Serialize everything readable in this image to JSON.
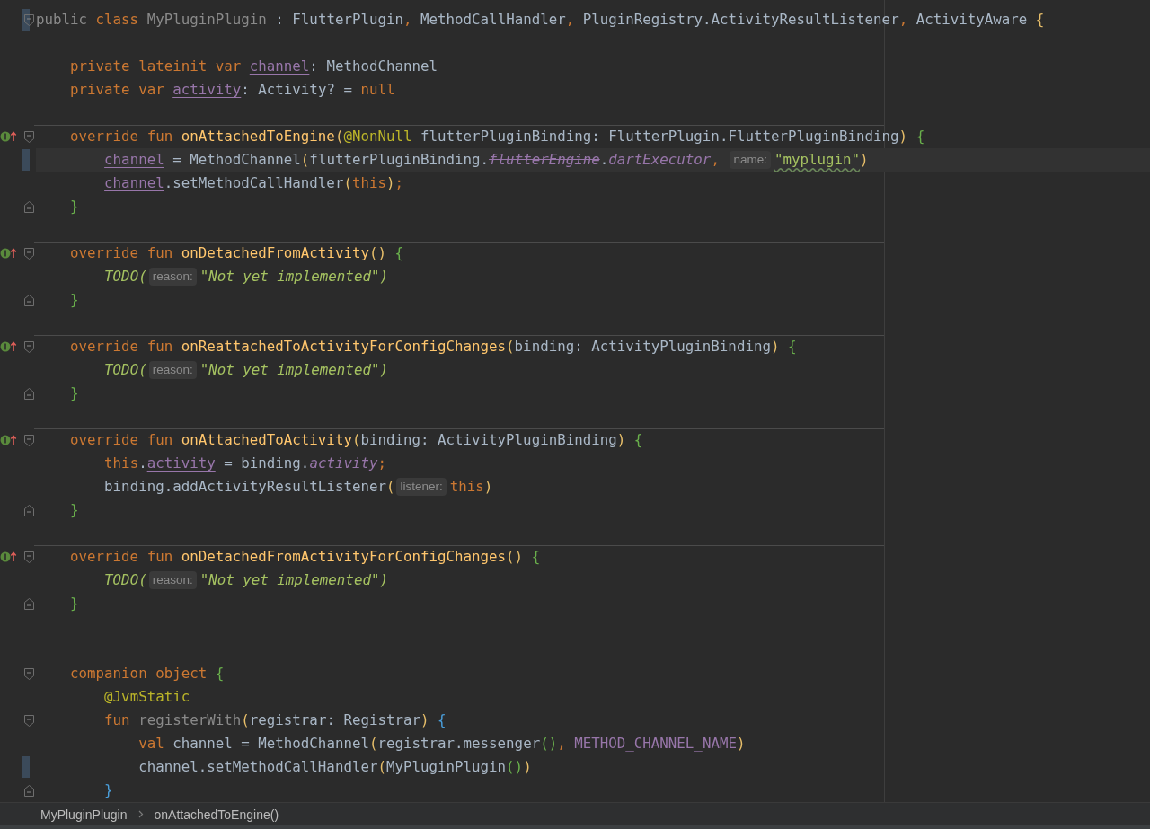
{
  "editor": {
    "lines": [
      {
        "kind": "code",
        "implements": false,
        "block_start": true,
        "block_end": false,
        "changed": true,
        "current": false,
        "separator": false,
        "tokens": [
          {
            "kind": "dim",
            "text": "public "
          },
          {
            "kind": "kw",
            "text": "class "
          },
          {
            "kind": "dim",
            "text": "MyPluginPlugin "
          },
          {
            "kind": "plain",
            "text": ": FlutterPlugin"
          },
          {
            "kind": "kw",
            "text": ", "
          },
          {
            "kind": "plain",
            "text": "MethodCallHandler"
          },
          {
            "kind": "kw",
            "text": ", "
          },
          {
            "kind": "plain",
            "text": "PluginRegistry.ActivityResultListener"
          },
          {
            "kind": "kw",
            "text": ", "
          },
          {
            "kind": "plain",
            "text": "ActivityAware "
          },
          {
            "kind": "brace-y",
            "text": "{"
          }
        ]
      },
      {
        "kind": "blank"
      },
      {
        "kind": "code",
        "implements": false,
        "block_start": false,
        "block_end": false,
        "changed": false,
        "current": false,
        "separator": false,
        "tokens": [
          {
            "kind": "kw",
            "text": "    private lateinit var "
          },
          {
            "kind": "field",
            "text": "channel"
          },
          {
            "kind": "plain",
            "text": ": MethodChannel"
          }
        ]
      },
      {
        "kind": "code",
        "implements": false,
        "block_start": false,
        "block_end": false,
        "changed": false,
        "current": false,
        "separator": false,
        "tokens": [
          {
            "kind": "kw",
            "text": "    private var "
          },
          {
            "kind": "field",
            "text": "activity"
          },
          {
            "kind": "plain",
            "text": ": Activity? = "
          },
          {
            "kind": "kw",
            "text": "null"
          }
        ]
      },
      {
        "kind": "blank"
      },
      {
        "kind": "code",
        "implements": true,
        "block_start": true,
        "block_end": false,
        "changed": false,
        "current": false,
        "separator": true,
        "tokens": [
          {
            "kind": "kw",
            "text": "    override fun "
          },
          {
            "kind": "decl",
            "text": "onAttachedToEngine"
          },
          {
            "kind": "brace-y",
            "text": "("
          },
          {
            "kind": "annot",
            "text": "@NonNull "
          },
          {
            "kind": "plain",
            "text": "flutterPluginBinding: FlutterPlugin.FlutterPluginBinding"
          },
          {
            "kind": "brace-y",
            "text": ") "
          },
          {
            "kind": "brace-g",
            "text": "{"
          }
        ]
      },
      {
        "kind": "code",
        "implements": false,
        "block_start": false,
        "block_end": false,
        "changed": true,
        "current": true,
        "separator": false,
        "tokens": [
          {
            "kind": "field",
            "text": "        channel"
          },
          {
            "kind": "plain",
            "text": " = MethodChannel"
          },
          {
            "kind": "brace-y",
            "text": "("
          },
          {
            "kind": "plain",
            "text": "flutterPluginBinding."
          },
          {
            "kind": "deprecated",
            "text": "flutterEngine"
          },
          {
            "kind": "plain",
            "text": "."
          },
          {
            "kind": "ifield",
            "text": "dartExecutor"
          },
          {
            "kind": "kw",
            "text": ", "
          },
          {
            "kind": "hint",
            "text": "name:"
          },
          {
            "kind": "string",
            "text": "\"myplugin\""
          },
          {
            "kind": "brace-y",
            "text": ")"
          }
        ]
      },
      {
        "kind": "code",
        "implements": false,
        "block_start": false,
        "block_end": false,
        "changed": false,
        "current": false,
        "separator": false,
        "tokens": [
          {
            "kind": "field",
            "text": "        channel"
          },
          {
            "kind": "plain",
            "text": ".setMethodCallHandler"
          },
          {
            "kind": "brace-y",
            "text": "("
          },
          {
            "kind": "kw",
            "text": "this"
          },
          {
            "kind": "brace-y",
            "text": ")"
          },
          {
            "kind": "kw",
            "text": ";"
          }
        ]
      },
      {
        "kind": "code",
        "implements": false,
        "block_start": false,
        "block_end": true,
        "changed": false,
        "current": false,
        "separator": false,
        "tokens": [
          {
            "kind": "brace-g",
            "text": "    }"
          }
        ]
      },
      {
        "kind": "blank"
      },
      {
        "kind": "code",
        "implements": true,
        "block_start": true,
        "block_end": false,
        "changed": false,
        "current": false,
        "separator": true,
        "tokens": [
          {
            "kind": "kw",
            "text": "    override fun "
          },
          {
            "kind": "decl",
            "text": "onDetachedFromActivity"
          },
          {
            "kind": "brace-y",
            "text": "() "
          },
          {
            "kind": "brace-g",
            "text": "{"
          }
        ]
      },
      {
        "kind": "code",
        "implements": false,
        "block_start": false,
        "block_end": false,
        "changed": false,
        "current": false,
        "separator": false,
        "tokens": [
          {
            "kind": "todo",
            "text": "        TODO("
          },
          {
            "kind": "hint",
            "text": "reason:"
          },
          {
            "kind": "todo",
            "text": "\"Not yet implemented\")"
          }
        ]
      },
      {
        "kind": "code",
        "implements": false,
        "block_start": false,
        "block_end": true,
        "changed": false,
        "current": false,
        "separator": false,
        "tokens": [
          {
            "kind": "brace-g",
            "text": "    }"
          }
        ]
      },
      {
        "kind": "blank"
      },
      {
        "kind": "code",
        "implements": true,
        "block_start": true,
        "block_end": false,
        "changed": false,
        "current": false,
        "separator": true,
        "tokens": [
          {
            "kind": "kw",
            "text": "    override fun "
          },
          {
            "kind": "decl",
            "text": "onReattachedToActivityForConfigChanges"
          },
          {
            "kind": "brace-y",
            "text": "("
          },
          {
            "kind": "plain",
            "text": "binding: ActivityPluginBinding"
          },
          {
            "kind": "brace-y",
            "text": ") "
          },
          {
            "kind": "brace-g",
            "text": "{"
          }
        ]
      },
      {
        "kind": "code",
        "implements": false,
        "block_start": false,
        "block_end": false,
        "changed": false,
        "current": false,
        "separator": false,
        "tokens": [
          {
            "kind": "todo",
            "text": "        TODO("
          },
          {
            "kind": "hint",
            "text": "reason:"
          },
          {
            "kind": "todo",
            "text": "\"Not yet implemented\")"
          }
        ]
      },
      {
        "kind": "code",
        "implements": false,
        "block_start": false,
        "block_end": true,
        "changed": false,
        "current": false,
        "separator": false,
        "tokens": [
          {
            "kind": "brace-g",
            "text": "    }"
          }
        ]
      },
      {
        "kind": "blank"
      },
      {
        "kind": "code",
        "implements": true,
        "block_start": true,
        "block_end": false,
        "changed": false,
        "current": false,
        "separator": true,
        "tokens": [
          {
            "kind": "kw",
            "text": "    override fun "
          },
          {
            "kind": "decl",
            "text": "onAttachedToActivity"
          },
          {
            "kind": "brace-y",
            "text": "("
          },
          {
            "kind": "plain",
            "text": "binding: ActivityPluginBinding"
          },
          {
            "kind": "brace-y",
            "text": ") "
          },
          {
            "kind": "brace-g",
            "text": "{"
          }
        ]
      },
      {
        "kind": "code",
        "implements": false,
        "block_start": false,
        "block_end": false,
        "changed": false,
        "current": false,
        "separator": false,
        "tokens": [
          {
            "kind": "kw",
            "text": "        this"
          },
          {
            "kind": "plain",
            "text": "."
          },
          {
            "kind": "field",
            "text": "activity"
          },
          {
            "kind": "plain",
            "text": " = binding."
          },
          {
            "kind": "ifield",
            "text": "activity"
          },
          {
            "kind": "kw",
            "text": ";"
          }
        ]
      },
      {
        "kind": "code",
        "implements": false,
        "block_start": false,
        "block_end": false,
        "changed": false,
        "current": false,
        "separator": false,
        "tokens": [
          {
            "kind": "plain",
            "text": "        binding.addActivityResultListener"
          },
          {
            "kind": "brace-y",
            "text": "("
          },
          {
            "kind": "hint",
            "text": "listener:"
          },
          {
            "kind": "kw",
            "text": "this"
          },
          {
            "kind": "brace-y",
            "text": ")"
          }
        ]
      },
      {
        "kind": "code",
        "implements": false,
        "block_start": false,
        "block_end": true,
        "changed": false,
        "current": false,
        "separator": false,
        "tokens": [
          {
            "kind": "brace-g",
            "text": "    }"
          }
        ]
      },
      {
        "kind": "blank"
      },
      {
        "kind": "code",
        "implements": true,
        "block_start": true,
        "block_end": false,
        "changed": false,
        "current": false,
        "separator": true,
        "tokens": [
          {
            "kind": "kw",
            "text": "    override fun "
          },
          {
            "kind": "decl",
            "text": "onDetachedFromActivityForConfigChanges"
          },
          {
            "kind": "brace-y",
            "text": "() "
          },
          {
            "kind": "brace-g",
            "text": "{"
          }
        ]
      },
      {
        "kind": "code",
        "implements": false,
        "block_start": false,
        "block_end": false,
        "changed": false,
        "current": false,
        "separator": false,
        "tokens": [
          {
            "kind": "todo",
            "text": "        TODO("
          },
          {
            "kind": "hint",
            "text": "reason:"
          },
          {
            "kind": "todo",
            "text": "\"Not yet implemented\")"
          }
        ]
      },
      {
        "kind": "code",
        "implements": false,
        "block_start": false,
        "block_end": true,
        "changed": false,
        "current": false,
        "separator": false,
        "tokens": [
          {
            "kind": "brace-g",
            "text": "    }"
          }
        ]
      },
      {
        "kind": "blank"
      },
      {
        "kind": "blank"
      },
      {
        "kind": "code",
        "implements": false,
        "block_start": true,
        "block_end": false,
        "changed": false,
        "current": false,
        "separator": false,
        "tokens": [
          {
            "kind": "kw",
            "text": "    companion object "
          },
          {
            "kind": "brace-g",
            "text": "{"
          }
        ]
      },
      {
        "kind": "code",
        "implements": false,
        "block_start": false,
        "block_end": false,
        "changed": false,
        "current": false,
        "separator": false,
        "tokens": [
          {
            "kind": "annot",
            "text": "        @JvmStatic"
          }
        ]
      },
      {
        "kind": "code",
        "implements": false,
        "block_start": true,
        "block_end": false,
        "changed": false,
        "current": false,
        "separator": false,
        "tokens": [
          {
            "kind": "kw",
            "text": "        fun "
          },
          {
            "kind": "dim",
            "text": "registerWith"
          },
          {
            "kind": "brace-y",
            "text": "("
          },
          {
            "kind": "plain",
            "text": "registrar: Registrar"
          },
          {
            "kind": "brace-y",
            "text": ") "
          },
          {
            "kind": "brace-b",
            "text": "{"
          }
        ]
      },
      {
        "kind": "code",
        "implements": false,
        "block_start": false,
        "block_end": false,
        "changed": false,
        "current": false,
        "separator": false,
        "tokens": [
          {
            "kind": "kw",
            "text": "            val "
          },
          {
            "kind": "plain",
            "text": "channel = MethodChannel"
          },
          {
            "kind": "brace-y",
            "text": "("
          },
          {
            "kind": "plain",
            "text": "registrar.messenger"
          },
          {
            "kind": "brace-g",
            "text": "()"
          },
          {
            "kind": "kw",
            "text": ", "
          },
          {
            "kind": "const",
            "text": "METHOD_CHANNEL_NAME"
          },
          {
            "kind": "brace-y",
            "text": ")"
          }
        ]
      },
      {
        "kind": "code",
        "implements": false,
        "block_start": false,
        "block_end": false,
        "changed": true,
        "current": false,
        "separator": false,
        "tokens": [
          {
            "kind": "plain",
            "text": "            channel.setMethodCallHandler"
          },
          {
            "kind": "brace-y",
            "text": "("
          },
          {
            "kind": "plain",
            "text": "MyPluginPlugin"
          },
          {
            "kind": "brace-g",
            "text": "()"
          },
          {
            "kind": "brace-y",
            "text": ")"
          }
        ]
      },
      {
        "kind": "code",
        "implements": false,
        "block_start": false,
        "block_end": true,
        "changed": false,
        "current": false,
        "separator": false,
        "tokens": [
          {
            "kind": "brace-b",
            "text": "        }"
          }
        ]
      }
    ]
  },
  "breadcrumbs": [
    "MyPluginPlugin",
    "onAttachedToEngine()"
  ]
}
